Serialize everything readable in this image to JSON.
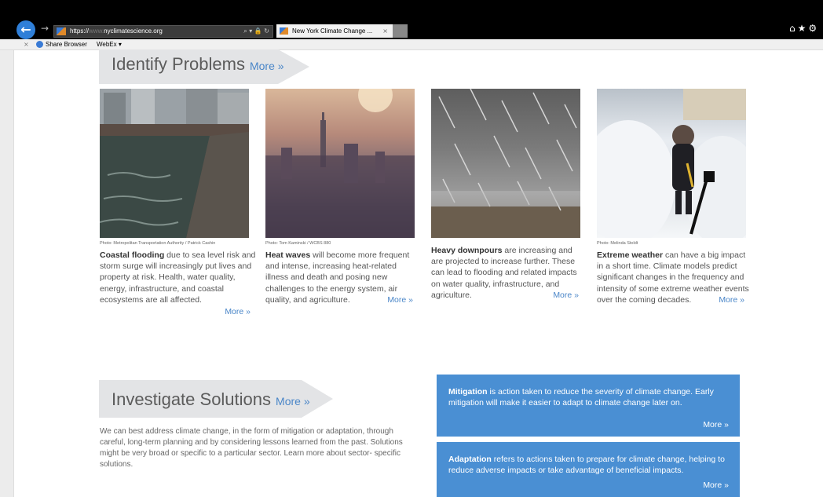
{
  "browser": {
    "address_scheme": "https://",
    "address_host_prefix": "www.",
    "address_domain": "nyclimatescience.org",
    "address_tools": "⌕ ▾ 🔒 ↻",
    "tab_title": "New York Climate Change ...",
    "tab_close": "×",
    "right_icons": "⌂★⚙"
  },
  "favorites_bar": {
    "close": "×",
    "share_browser": "Share Browser",
    "webex": "WebEx ▾"
  },
  "identify": {
    "title": "Identify Problems",
    "more": "More »",
    "cards": [
      {
        "credit": "Photo: Metropolitan Transportation Authority / Patrick Cashin",
        "term": "Coastal flooding",
        "text": " due to sea level risk and storm surge will increasingly put lives and property at risk. Health, water quality, energy, infrastructure, and coastal ecosystems are all affected.",
        "more": "More »"
      },
      {
        "credit": "Photo: Tom Kaminski / WCBS 880",
        "term": "Heat waves",
        "text": " will become more frequent and intense, increasing heat-related illness and death and posing new challenges to the energy system, air quality, and agriculture.",
        "more": "More »"
      },
      {
        "credit": "",
        "term": "Heavy downpours",
        "text": " are increasing and are projected to increase further. These can lead to flooding and related impacts on water quality, infrastructure, and agriculture.",
        "more": "More »"
      },
      {
        "credit": "Photo: Melinda Stoldt",
        "term": "Extreme weather",
        "text": " can have a big impact in a short time. Climate models predict significant changes in the frequency and intensity of some extreme weather events over the coming decades.",
        "more": "More »"
      }
    ]
  },
  "investigate": {
    "title": "Investigate Solutions",
    "more": "More »",
    "text": "We can best address climate change, in the form of mitigation or adaptation, through careful, long-term planning and by considering lessons learned from the past. Solutions might be very broad or specific to a particular sector. Learn more about sector- specific solutions."
  },
  "solutions": [
    {
      "term": "Mitigation",
      "text": " is action taken to reduce the severity of climate change. Early mitigation will make it easier to adapt to climate change later on.",
      "more": "More »"
    },
    {
      "term": "Adaptation",
      "text": " refers to actions taken to prepare for climate change, helping to reduce adverse impacts or take advantage of beneficial impacts.",
      "more": "More »"
    }
  ],
  "colors": {
    "link_blue": "#4a86c8",
    "box_blue": "#4a8fd3",
    "banner_gray": "#e3e4e6"
  }
}
